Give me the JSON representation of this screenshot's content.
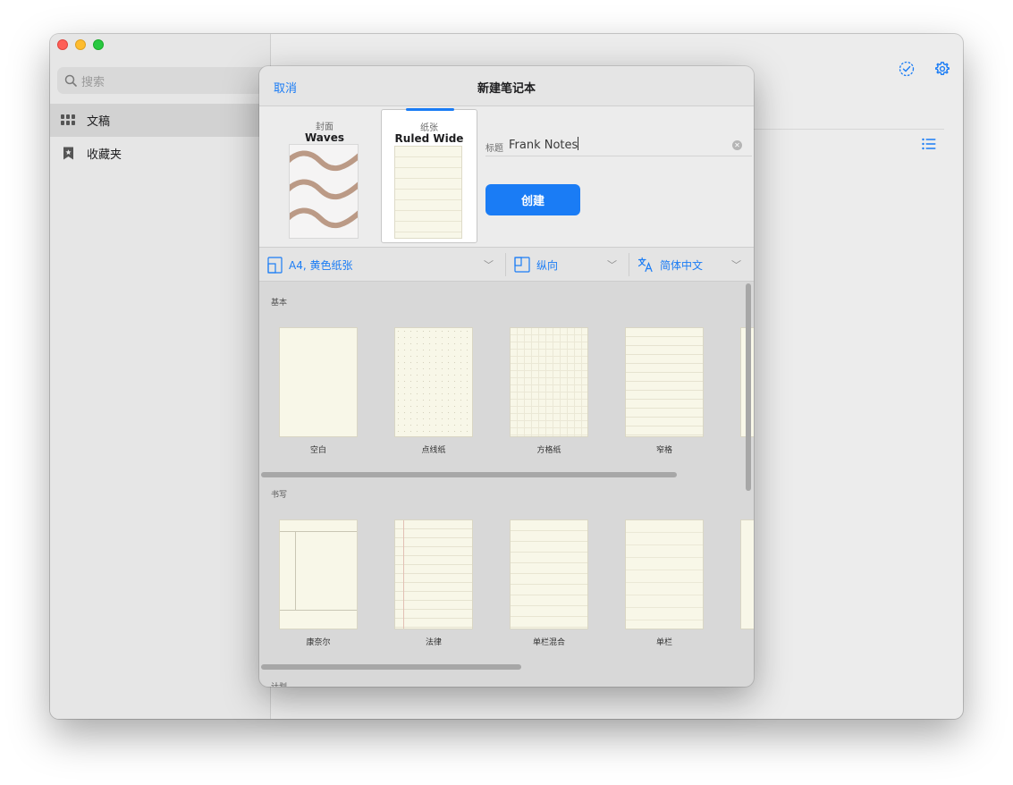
{
  "sidebar": {
    "search_placeholder": "搜索",
    "items": [
      {
        "label": "文稿",
        "active": true
      },
      {
        "label": "收藏夹",
        "active": false
      }
    ]
  },
  "toolbar_icons": [
    "checkmark-circle-icon",
    "gear-icon",
    "list-icon"
  ],
  "modal": {
    "cancel": "取消",
    "title": "新建笔记本",
    "cover": {
      "caption": "封面",
      "name": "Waves"
    },
    "paper": {
      "caption": "纸张",
      "name": "Ruled Wide"
    },
    "title_label": "标题",
    "title_value": "Frank Notes",
    "create_label": "创建",
    "options": {
      "size": "A4, 黄色纸张",
      "orientation": "纵向",
      "language": "简体中文"
    },
    "sections": [
      {
        "title": "基本",
        "tiles": [
          "空白",
          "点线纸",
          "方格纸",
          "窄格"
        ]
      },
      {
        "title": "书写",
        "tiles": [
          "康奈尔",
          "法律",
          "单栏混合",
          "单栏"
        ]
      },
      {
        "title": "计划"
      }
    ]
  },
  "colors": {
    "accent": "#1a7cf5",
    "wave": "#bb9a86",
    "paper": "#f8f7e8"
  }
}
